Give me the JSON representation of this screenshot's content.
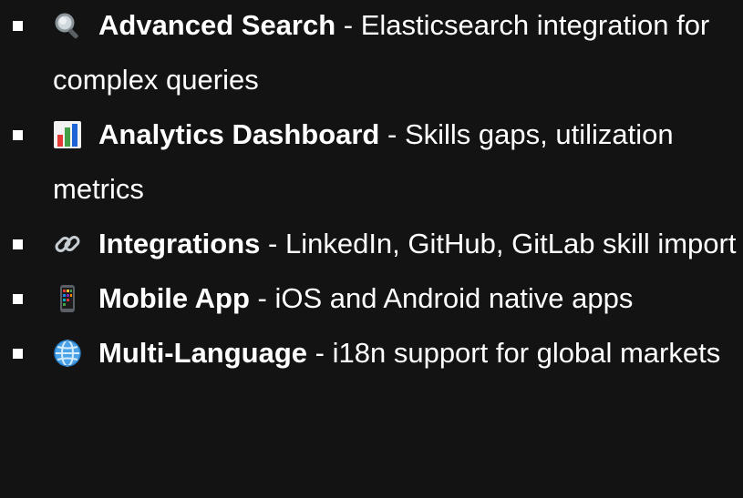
{
  "features": [
    {
      "icon": "magnifying-glass-icon",
      "title": "Advanced Search",
      "separator": " - ",
      "description": "Elasticsearch integration for complex queries"
    },
    {
      "icon": "bar-chart-icon",
      "title": "Analytics Dashboard",
      "separator": " - ",
      "description": "Skills gaps, utilization metrics"
    },
    {
      "icon": "link-icon",
      "title": "Integrations",
      "separator": " - ",
      "description": "LinkedIn, GitHub, GitLab skill import"
    },
    {
      "icon": "mobile-phone-icon",
      "title": "Mobile App",
      "separator": " - ",
      "description": "iOS and Android native apps"
    },
    {
      "icon": "globe-icon",
      "title": "Multi-Language",
      "separator": " - ",
      "description": "i18n support for global markets"
    }
  ],
  "colors": {
    "background": "#131313",
    "text": "#ffffff"
  }
}
